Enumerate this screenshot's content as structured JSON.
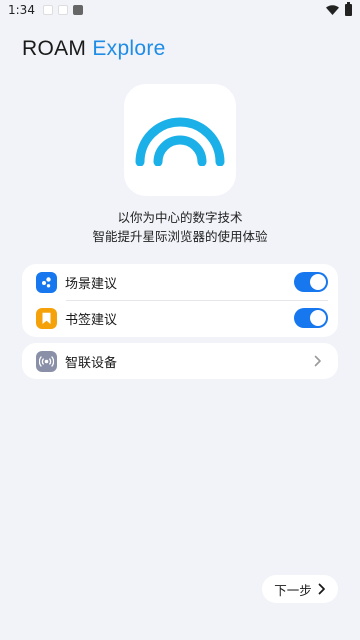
{
  "status_bar": {
    "time": "1:34"
  },
  "header": {
    "brand": "ROAM",
    "product": "Explore",
    "accent_color": "#1f8ce6"
  },
  "logo": {
    "icon": "roam-rainbow-logo",
    "color": "#1cb0e8"
  },
  "description": {
    "line1": "以你为中心的数字技术",
    "line2": "智能提升星际浏览器的使用体验"
  },
  "settings": {
    "items": [
      {
        "label": "场景建议",
        "icon": "scene-suggestion-icon",
        "icon_color": "#1677ee",
        "enabled": true
      },
      {
        "label": "书签建议",
        "icon": "bookmark-icon",
        "icon_color": "#f5a20a",
        "enabled": true
      }
    ]
  },
  "devices": {
    "label": "智联设备",
    "icon": "broadcast-icon",
    "icon_color": "#8a90a8"
  },
  "footer": {
    "next_label": "下一步"
  }
}
